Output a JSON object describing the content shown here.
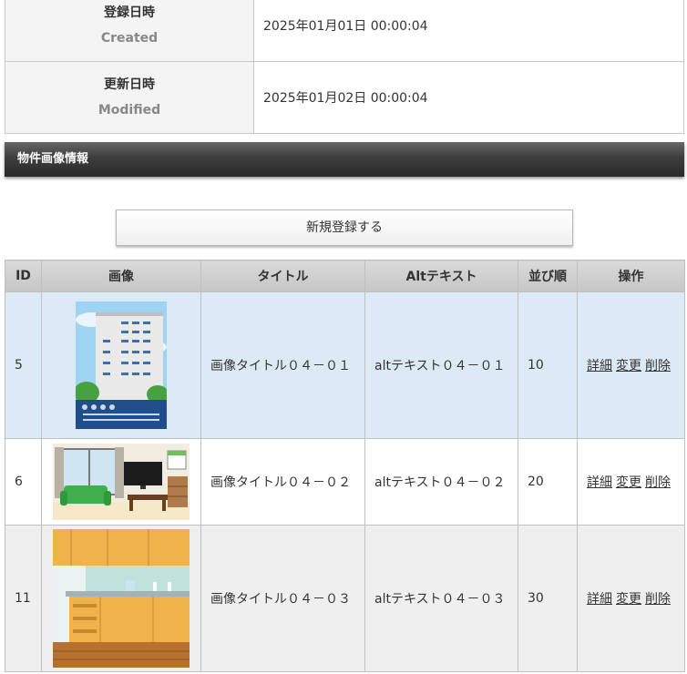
{
  "info": {
    "created_jp": "登録日時",
    "created_en": "Created",
    "created_value": "2025年01月01日 00:00:04",
    "modified_jp": "更新日時",
    "modified_en": "Modified",
    "modified_value": "2025年01月02日 00:00:04"
  },
  "section": {
    "title": "物件画像情報"
  },
  "new_button": {
    "label": "新規登録する"
  },
  "table": {
    "headers": [
      "ID",
      "画像",
      "タイトル",
      "Altテキスト",
      "並び順",
      "操作"
    ],
    "rows": [
      {
        "id": "5",
        "title": "画像タイトル０４－０１",
        "alt": "altテキスト０４－０１",
        "order": "10",
        "image": "apartment-building-icon"
      },
      {
        "id": "6",
        "title": "画像タイトル０４－０２",
        "alt": "altテキスト０４－０２",
        "order": "20",
        "image": "living-room-icon"
      },
      {
        "id": "11",
        "title": "画像タイトル０４－０３",
        "alt": "altテキスト０４－０３",
        "order": "30",
        "image": "kitchen-icon"
      }
    ],
    "ops": {
      "detail": "詳細",
      "edit": "変更",
      "delete": "削除"
    }
  },
  "colors": {
    "selected_row": "#dbeaf6",
    "header_bar": "#3d3d3d"
  }
}
